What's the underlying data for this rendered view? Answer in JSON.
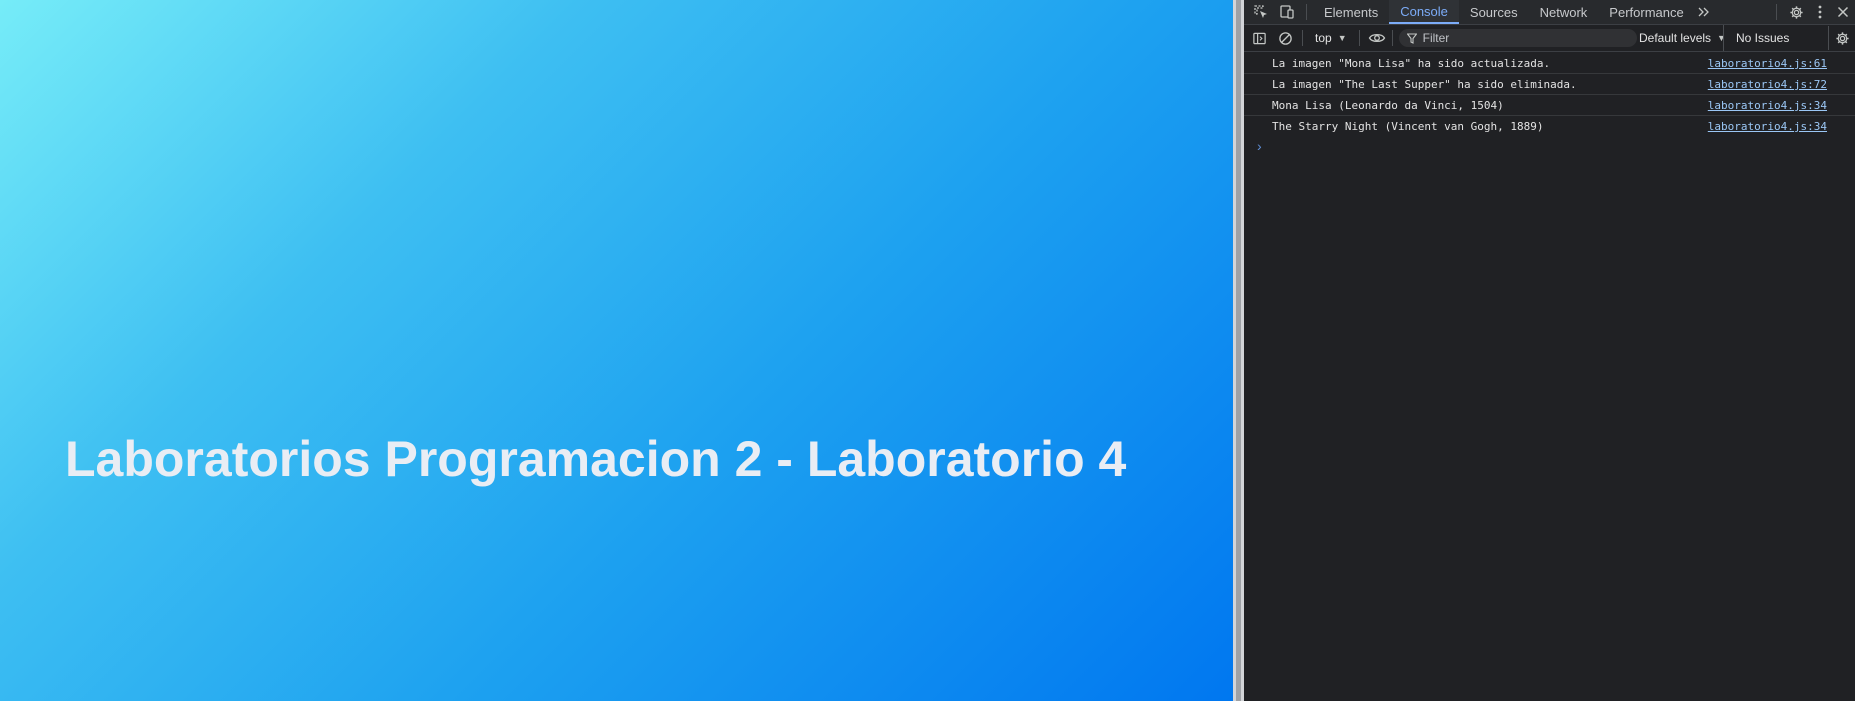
{
  "page": {
    "heading": "Laboratorios Programacion 2 - Laboratorio 4"
  },
  "devtools": {
    "tabs": [
      {
        "label": "Elements"
      },
      {
        "label": "Console"
      },
      {
        "label": "Sources"
      },
      {
        "label": "Network"
      },
      {
        "label": "Performance"
      }
    ],
    "active_tab": "Console",
    "toolbar": {
      "context": "top",
      "filter_placeholder": "Filter",
      "levels": "Default levels",
      "issues": "No Issues"
    },
    "console_messages": [
      {
        "text": "La imagen \"Mona Lisa\" ha sido actualizada.",
        "source": "laboratorio4.js:61"
      },
      {
        "text": "La imagen \"The Last Supper\" ha sido eliminada.",
        "source": "laboratorio4.js:72"
      },
      {
        "text": "Mona Lisa (Leonardo da Vinci, 1504)",
        "source": "laboratorio4.js:34"
      },
      {
        "text": "The Starry Night (Vincent van Gogh, 1889)",
        "source": "laboratorio4.js:34"
      }
    ],
    "prompt_glyph": "›"
  },
  "colors": {
    "gradient_start": "#76ecf8",
    "gradient_end": "#0077f0",
    "heading": "#e9edf4",
    "devtools_bg": "#202124",
    "active_tab": "#7cacf8",
    "link": "#9bc7f5"
  }
}
